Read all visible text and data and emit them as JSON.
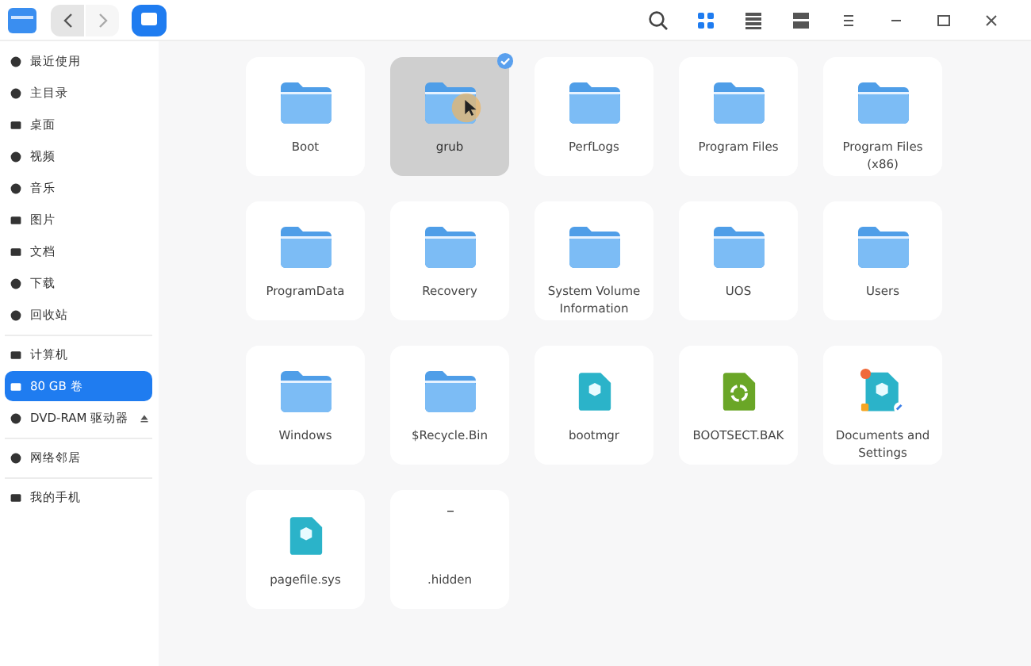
{
  "toolbar": {
    "back": {
      "disabled": false
    },
    "forward": {
      "disabled": true
    },
    "view_modes": [
      {
        "selected": true
      },
      {
        "selected": false
      },
      {
        "selected": false
      }
    ]
  },
  "sidebar": {
    "groups": [
      [
        {
          "label": "最近使用",
          "selected": false
        },
        {
          "label": "主目录",
          "selected": false
        },
        {
          "label": "桌面",
          "selected": false
        },
        {
          "label": "视频",
          "selected": false
        },
        {
          "label": "音乐",
          "selected": false
        },
        {
          "label": "图片",
          "selected": false
        },
        {
          "label": "文档",
          "selected": false
        },
        {
          "label": "下载",
          "selected": false
        },
        {
          "label": "回收站",
          "selected": false
        }
      ],
      [
        {
          "label": "计算机",
          "selected": false
        },
        {
          "label": "80 GB 卷",
          "selected": true
        },
        {
          "label": "DVD-RAM 驱动器",
          "selected": false,
          "ejectable": true
        }
      ],
      [
        {
          "label": "网络邻居",
          "selected": false
        }
      ],
      [
        {
          "label": "我的手机",
          "selected": false
        }
      ]
    ]
  },
  "files": [
    {
      "name": "Boot",
      "kind": "folder",
      "selected": false
    },
    {
      "name": "grub",
      "kind": "folder",
      "selected": true
    },
    {
      "name": "PerfLogs",
      "kind": "folder",
      "selected": false
    },
    {
      "name": "Program Files",
      "kind": "folder",
      "selected": false
    },
    {
      "name": "Program Files (x86)",
      "kind": "folder",
      "selected": false
    },
    {
      "name": "ProgramData",
      "kind": "folder",
      "selected": false
    },
    {
      "name": "Recovery",
      "kind": "folder",
      "selected": false
    },
    {
      "name": "System Volume Information",
      "kind": "folder",
      "selected": false
    },
    {
      "name": "UOS",
      "kind": "folder",
      "selected": false
    },
    {
      "name": "Users",
      "kind": "folder",
      "selected": false
    },
    {
      "name": "Windows",
      "kind": "folder",
      "selected": false
    },
    {
      "name": "$Recycle.Bin",
      "kind": "folder",
      "selected": false
    },
    {
      "name": "bootmgr",
      "kind": "package",
      "selected": false
    },
    {
      "name": "BOOTSECT.BAK",
      "kind": "recycle",
      "selected": false
    },
    {
      "name": "Documents and Settings",
      "kind": "link",
      "selected": false
    },
    {
      "name": "pagefile.sys",
      "kind": "package",
      "selected": false
    },
    {
      "name": ".hidden",
      "kind": "blank",
      "selected": false
    }
  ]
}
